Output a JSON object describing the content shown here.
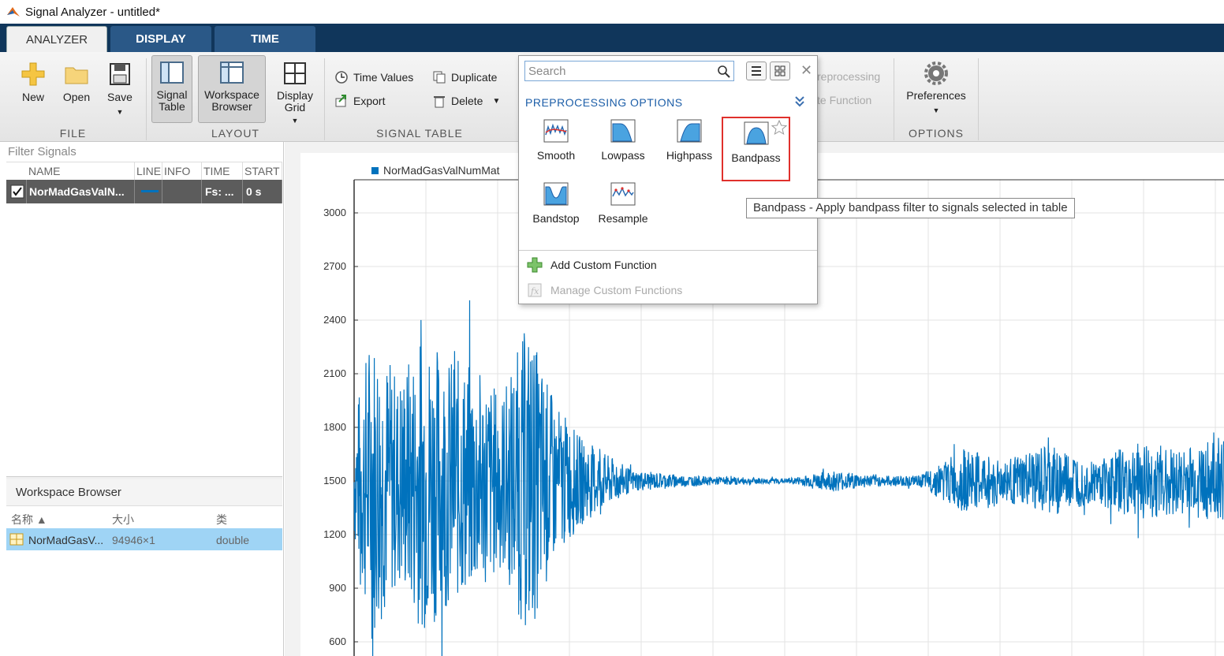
{
  "window": {
    "title": "Signal Analyzer - untitled*"
  },
  "tabs": [
    {
      "label": "ANALYZER"
    },
    {
      "label": "DISPLAY"
    },
    {
      "label": "TIME"
    }
  ],
  "ribbon": {
    "file": {
      "label": "FILE",
      "new": "New",
      "open": "Open",
      "save": "Save"
    },
    "layout": {
      "label": "LAYOUT",
      "signal_table": [
        "Signal",
        "Table"
      ],
      "workspace_browser": [
        "Workspace",
        "Browser"
      ],
      "display_grid": [
        "Display",
        "Grid"
      ]
    },
    "signal_table": {
      "label": "SIGNAL TABLE",
      "time_values": "Time Values",
      "duplicate": "Duplicate",
      "export": "Export",
      "delete": "Delete"
    },
    "preprocessing_partial": {
      "top": "reprocessing",
      "bottom": "te Function"
    },
    "options": {
      "label": "OPTIONS",
      "preferences": "Preferences"
    }
  },
  "signal_table": {
    "filter_placeholder": "Filter Signals",
    "columns": [
      "NAME",
      "LINE",
      "INFO",
      "TIME",
      "START"
    ],
    "row": {
      "name": "NorMadGasValN...",
      "line_color": "#0072bd",
      "info": "",
      "time": "Fs: ...",
      "start": "0 s",
      "checked": true
    }
  },
  "workspace_browser": {
    "title": "Workspace Browser",
    "columns": [
      "名称 ▲",
      "大小",
      "类"
    ],
    "row": {
      "name": "NorMadGasV...",
      "size": "94946×1",
      "class": "double"
    }
  },
  "plot": {
    "legend": "NorMadGasValNumMat",
    "line_color": "#0072bd"
  },
  "chart_data": {
    "type": "line",
    "title": "",
    "xlabel": "",
    "ylabel": "",
    "series": [
      {
        "name": "NorMadGasValNumMat"
      }
    ],
    "yticks": [
      600,
      900,
      1200,
      1500,
      1800,
      2100,
      2400,
      2700,
      3000
    ],
    "ylim": [
      470,
      3100
    ],
    "grid": true,
    "legend_position": "top-left",
    "envelope": [
      {
        "x": 0.0,
        "amp": 350
      },
      {
        "x": 0.02,
        "amp": 900
      },
      {
        "x": 0.05,
        "amp": 600
      },
      {
        "x": 0.08,
        "amp": 850
      },
      {
        "x": 0.11,
        "amp": 700
      },
      {
        "x": 0.14,
        "amp": 650
      },
      {
        "x": 0.17,
        "amp": 500
      },
      {
        "x": 0.2,
        "amp": 900
      },
      {
        "x": 0.23,
        "amp": 450
      },
      {
        "x": 0.26,
        "amp": 250
      },
      {
        "x": 0.29,
        "amp": 150
      },
      {
        "x": 0.32,
        "amp": 60
      },
      {
        "x": 0.4,
        "amp": 25
      },
      {
        "x": 0.5,
        "amp": 15
      },
      {
        "x": 0.55,
        "amp": 60
      },
      {
        "x": 0.6,
        "amp": 30
      },
      {
        "x": 0.65,
        "amp": 30
      },
      {
        "x": 0.7,
        "amp": 180
      },
      {
        "x": 0.75,
        "amp": 120
      },
      {
        "x": 0.8,
        "amp": 200
      },
      {
        "x": 0.85,
        "amp": 120
      },
      {
        "x": 0.9,
        "amp": 220
      },
      {
        "x": 0.95,
        "amp": 180
      },
      {
        "x": 1.0,
        "amp": 250
      }
    ]
  },
  "popup": {
    "search_placeholder": "Search",
    "title": "PREPROCESSING OPTIONS",
    "items": [
      {
        "label": "Smooth"
      },
      {
        "label": "Lowpass"
      },
      {
        "label": "Highpass"
      },
      {
        "label": "Bandpass"
      },
      {
        "label": "Bandstop"
      },
      {
        "label": "Resample"
      }
    ],
    "add_custom": "Add Custom Function",
    "manage_custom": "Manage Custom Functions",
    "tooltip": "Bandpass - Apply bandpass filter to signals selected in table"
  }
}
